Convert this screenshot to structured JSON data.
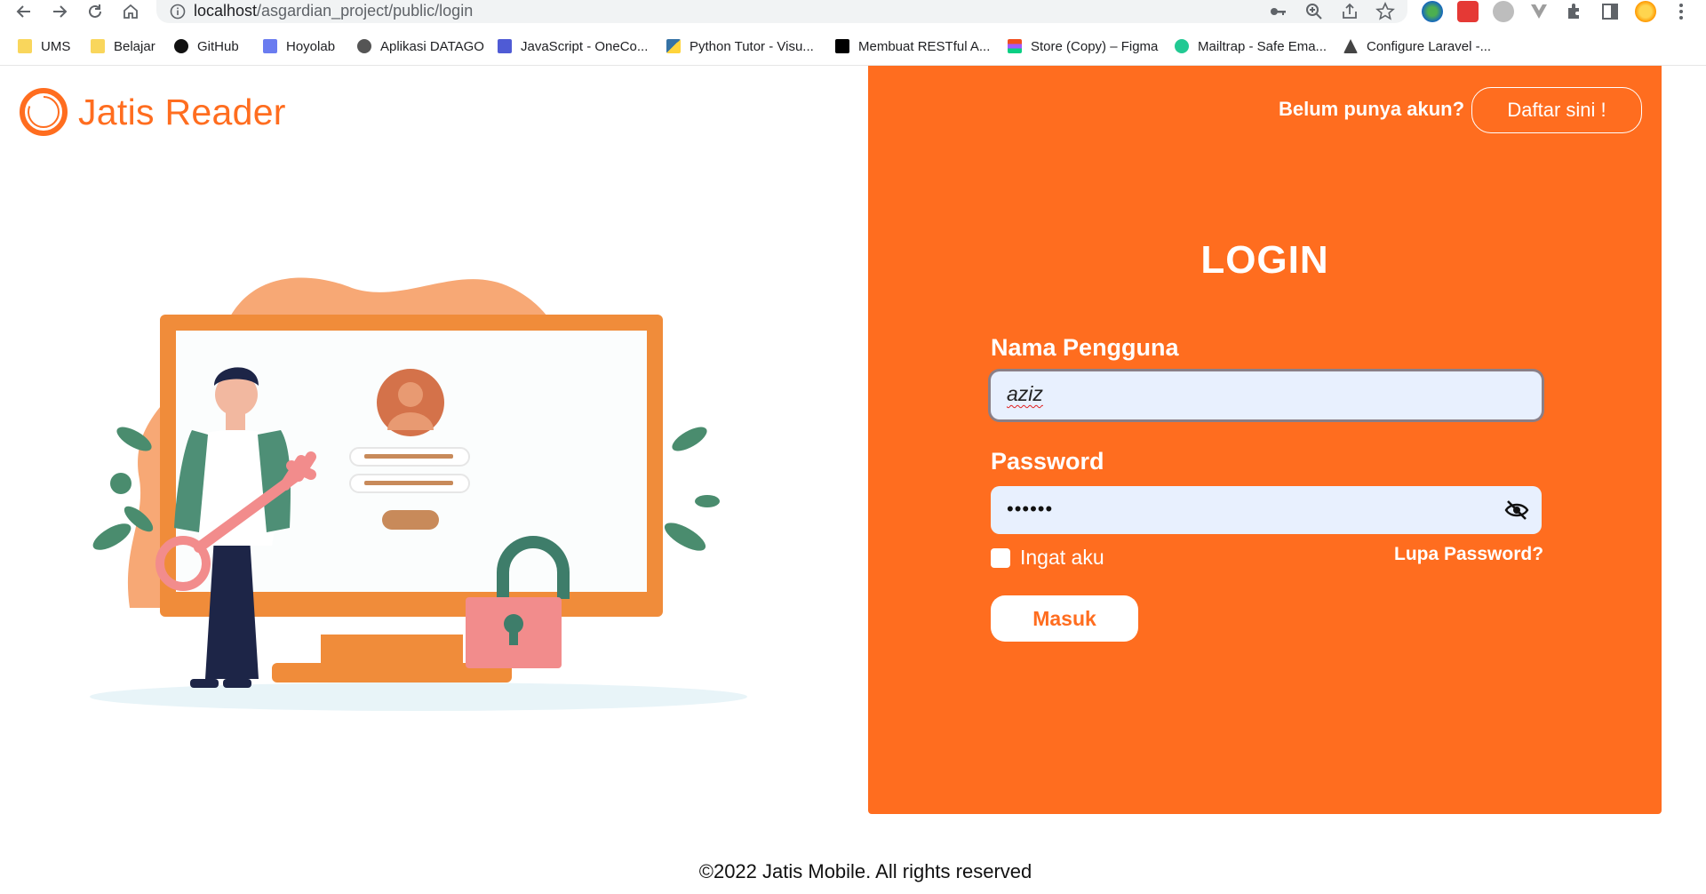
{
  "browser": {
    "url_host": "localhost",
    "url_path": "/asgardian_project/public/login",
    "bookmarks": [
      {
        "label": "UMS",
        "icon": "folder-icon"
      },
      {
        "label": "Belajar",
        "icon": "folder-icon"
      },
      {
        "label": "GitHub",
        "icon": "github-icon"
      },
      {
        "label": "Hoyolab",
        "icon": "hoyolab-icon"
      },
      {
        "label": "Aplikasi DATAGO",
        "icon": "globe-icon"
      },
      {
        "label": "JavaScript - OneCo...",
        "icon": "code-icon"
      },
      {
        "label": "Python Tutor - Visu...",
        "icon": "python-icon"
      },
      {
        "label": "Membuat RESTful A...",
        "icon": "medium-icon"
      },
      {
        "label": "Store (Copy) – Figma",
        "icon": "figma-icon"
      },
      {
        "label": "Mailtrap - Safe Ema...",
        "icon": "mailtrap-icon"
      },
      {
        "label": "Configure Laravel -...",
        "icon": "laravel-icon"
      }
    ]
  },
  "brand": {
    "name": "Jatis Reader",
    "accent": "#ff6d1f"
  },
  "header": {
    "signup_question": "Belum punya akun?",
    "signup_button": "Daftar sini !"
  },
  "login": {
    "title": "LOGIN",
    "username_label": "Nama Pengguna",
    "username_value": "aziz",
    "password_label": "Password",
    "password_masked": "••••••",
    "remember_label": "Ingat aku",
    "remember_checked": false,
    "forgot_label": "Lupa Password?",
    "submit_label": "Masuk"
  },
  "footer": {
    "text": "©2022 Jatis Mobile. All rights reserved"
  }
}
